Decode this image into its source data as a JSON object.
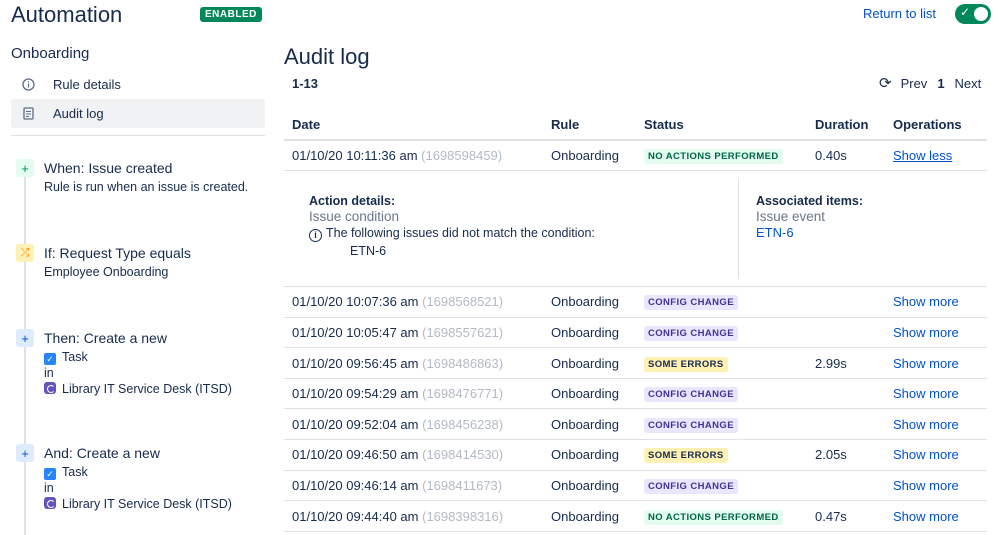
{
  "header": {
    "title": "Automation",
    "badge": "ENABLED",
    "return_link": "Return to list",
    "toggle_check": "✓"
  },
  "sidebar": {
    "heading": "Onboarding",
    "nav": [
      {
        "label": "Rule details",
        "icon": "info-icon"
      },
      {
        "label": "Audit log",
        "icon": "document-icon"
      }
    ],
    "flow": [
      {
        "icon": "plus-icon",
        "title": "When: Issue created",
        "lines": [
          "Rule is run when an issue is created."
        ]
      },
      {
        "icon": "shuffle-icon",
        "title": "If: Request Type equals",
        "lines": [
          "Employee Onboarding"
        ]
      },
      {
        "icon": "plus-icon",
        "title": "Then: Create a new",
        "task": "Task",
        "in": "in",
        "project": "Library IT Service Desk (ITSD)"
      },
      {
        "icon": "plus-icon",
        "title": "And: Create a new",
        "task": "Task",
        "in": "in",
        "project": "Library IT Service Desk (ITSD)"
      }
    ]
  },
  "main": {
    "title": "Audit log",
    "range": "1-13",
    "pager": {
      "prev": "Prev",
      "page": "1",
      "next": "Next"
    },
    "columns": [
      "Date",
      "Rule",
      "Status",
      "Duration",
      "Operations"
    ],
    "rows": [
      {
        "date": "01/10/20 10:11:36 am",
        "ts": "(1698598459)",
        "rule": "Onboarding",
        "status": "NO ACTIONS PERFORMED",
        "kind": "success",
        "duration": "0.40s",
        "op": "Show less"
      },
      {
        "date": "01/10/20 10:07:36 am",
        "ts": "(1698568521)",
        "rule": "Onboarding",
        "status": "CONFIG CHANGE",
        "kind": "config",
        "duration": "",
        "op": "Show more"
      },
      {
        "date": "01/10/20 10:05:47 am",
        "ts": "(1698557621)",
        "rule": "Onboarding",
        "status": "CONFIG CHANGE",
        "kind": "config",
        "duration": "",
        "op": "Show more"
      },
      {
        "date": "01/10/20 09:56:45 am",
        "ts": "(1698486863)",
        "rule": "Onboarding",
        "status": "SOME ERRORS",
        "kind": "error",
        "duration": "2.99s",
        "op": "Show more"
      },
      {
        "date": "01/10/20 09:54:29 am",
        "ts": "(1698476771)",
        "rule": "Onboarding",
        "status": "CONFIG CHANGE",
        "kind": "config",
        "duration": "",
        "op": "Show more"
      },
      {
        "date": "01/10/20 09:52:04 am",
        "ts": "(1698456238)",
        "rule": "Onboarding",
        "status": "CONFIG CHANGE",
        "kind": "config",
        "duration": "",
        "op": "Show more"
      },
      {
        "date": "01/10/20 09:46:50 am",
        "ts": "(1698414530)",
        "rule": "Onboarding",
        "status": "SOME ERRORS",
        "kind": "error",
        "duration": "2.05s",
        "op": "Show more"
      },
      {
        "date": "01/10/20 09:46:14 am",
        "ts": "(1698411673)",
        "rule": "Onboarding",
        "status": "CONFIG CHANGE",
        "kind": "config",
        "duration": "",
        "op": "Show more"
      },
      {
        "date": "01/10/20 09:44:40 am",
        "ts": "(1698398316)",
        "rule": "Onboarding",
        "status": "NO ACTIONS PERFORMED",
        "kind": "success",
        "duration": "0.47s",
        "op": "Show more"
      }
    ],
    "details": {
      "action_heading": "Action details:",
      "action_value": "Issue condition",
      "info_text": "The following issues did not match the condition:",
      "issue_key": "ETN-6",
      "assoc_heading": "Associated items:",
      "assoc_value": "Issue event",
      "assoc_link": "ETN-6"
    }
  }
}
